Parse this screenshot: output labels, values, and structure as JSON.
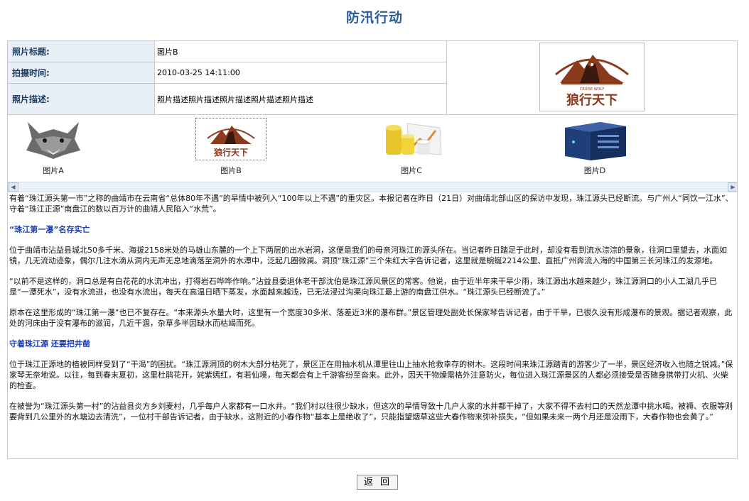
{
  "page": {
    "title": "防汛行动"
  },
  "info": {
    "photo_title_label": "照片标题:",
    "photo_title_value": "图片B",
    "shoot_time_label": "拍摄时间:",
    "shoot_time_value": "2010-03-25 14:11:00",
    "desc_label": "照片描述:",
    "desc_value": "照片描述照片描述照片描述照片描述照片描述"
  },
  "main_photo": {
    "logo_text": "狼行天下",
    "logo_sub": "CRUISE WOLF"
  },
  "thumbnails": [
    {
      "caption": "图片A",
      "icon": "wolf-head-icon"
    },
    {
      "caption": "图片B",
      "icon": "wolf-logo-icon",
      "selected": true
    },
    {
      "caption": "图片C",
      "icon": "charts-icon"
    },
    {
      "caption": "图片D",
      "icon": "server-icon"
    }
  ],
  "article": {
    "p1": "有着“珠江源头第一市”之称的曲靖市在云南省“总体80年不遇”的旱情中被列入“100年以上不遇”的重灾区。本报记者在昨日（21日）对曲靖北部山区的探访中发现，珠江源头已经断流。与广州人“同饮一江水”、守着“珠江正源”南盘江的数以百万计的曲靖人民陷入“水荒”。",
    "h1": "“珠江第一瀑”名存实亡",
    "p2": "位于曲靖市沾益县城北50多千米、海拔2158米处的马雄山东麓的一个上下两层的出水岩洞，这便是我们的母亲河珠江的源头所在。当记者昨日踏足于此时，却没有看到流水淙淙的景象，往洞口里望去，水面如镜，几无流动迹象，偶尔几注水滴从洞内无声无息地滴落至洞外的水潭中，泛起几圈微澜。洞顶“珠江源”三个朱红大字告诉记者，这里就是蜿蜒2214公里、直抵广州奔流入海的中国第三长河珠江的发源地。",
    "p3": "“以前不是这样的，洞口总是有白花花的水流冲出，打得岩石哗哗作响。”沾益县委退休老干部沈伯是珠江源风景区的常客。他说，由于近半年来干旱少雨，珠江源出水越来越少，珠江源洞口的小人工湖几乎已是“一潭死水”，没有水流进，也没有水流出，每天在高温日晒下蒸发，水面越来越浅，已无法浸过沟渠向珠江最上游的南盘江供水。“珠江源头已经断流了。”",
    "p4": "原本在这里形成的“珠江第一瀑”也已不复存在。“本来源头水量大时，这里有一个宽度30多米、落差近3米的瀑布群。”景区管理处副处长保家琴告诉记者，由于干旱，已很久没有形成瀑布的景观。据记者观察，此处的河床由于没有瀑布的滋润，几近干涸，杂草多半因缺水而枯竭而死。",
    "h2": "守着珠江源 还要把井凿",
    "p5": "位于珠江正源地的植被同样受到了“干渴”的困扰。“珠江源洞顶的树木大部分枯死了，景区正在用抽水机从潭里往山上抽水抢救幸存的树木。这段时间来珠江源踏青的游客少了一半，景区经济收入也随之锐减。”保家琴无奈地说。以往，每到春末夏初，这里杜鹃花开，姹紫嫣红，有若仙境，每天都会有上千游客纷至沓来。此外，因天干物燥需格外注意防火，每位进入珠江源景区的人都必须接受是否随身携带打火机、火柴的检查。",
    "p6": "在被誉为“珠江源头第一村”的沾益县炎方乡刘麦村，几乎每户人家都有一口水井。“我们村以往很少缺水，但这次的旱情导致十几户人家的水井都干掉了，大家不得不去村口的天然龙潭中挑水喝。被褥、衣服等则要背到几公里外的水塘边去清洗”，一位村干部告诉记者，由于缺水，这附近的小春作物“基本上是绝收了”，只能指望烟草这些大春作物来弥补损失，“但如果未来一两个月还是没雨下，大春作物也会黄了。”"
  },
  "buttons": {
    "back": "返回"
  },
  "colors": {
    "title": "#2a5c98",
    "label_bg": "#e9eff6",
    "heading": "#1a3fb5",
    "logo_brown": "#8b3a1e"
  }
}
